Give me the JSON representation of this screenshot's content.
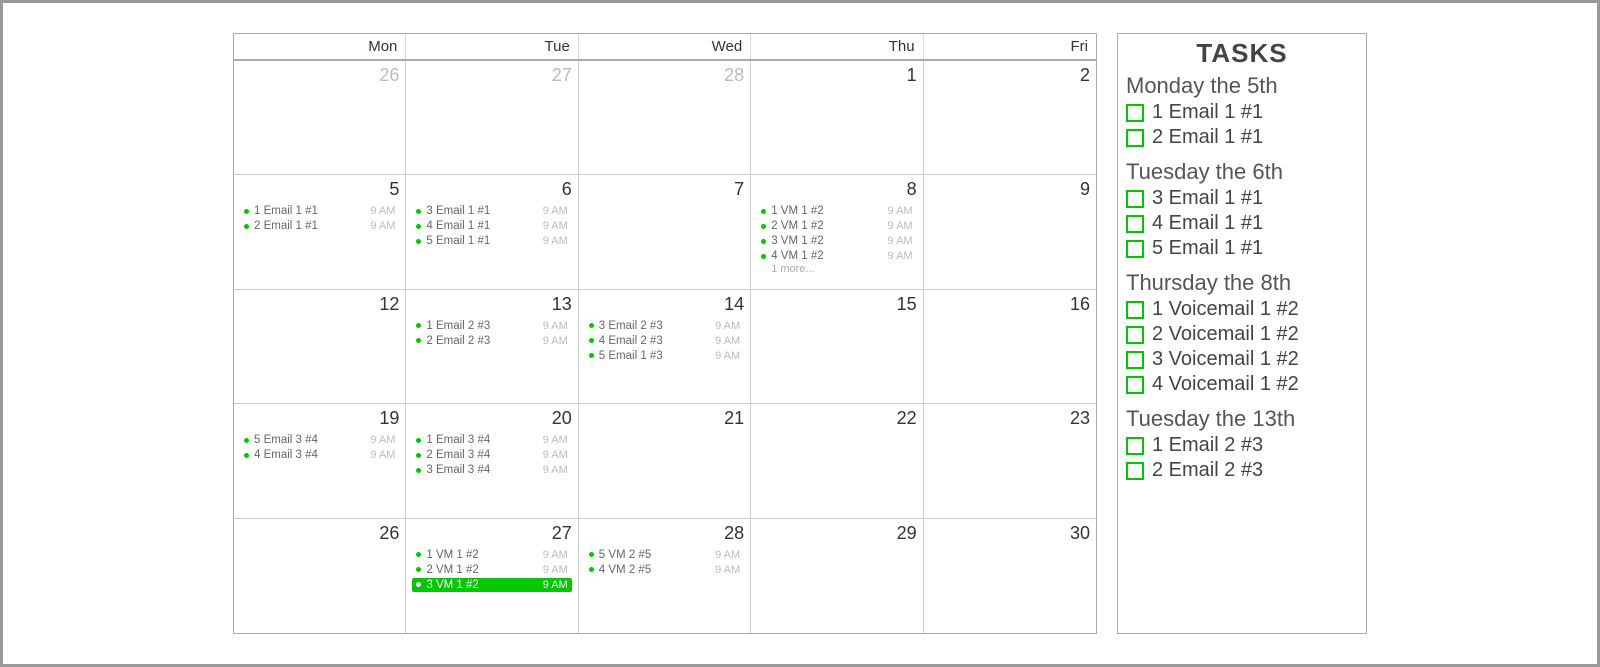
{
  "calendar": {
    "headers": [
      "Mon",
      "Tue",
      "Wed",
      "Thu",
      "Fri"
    ],
    "weeks": [
      [
        {
          "num": "26",
          "faded": true,
          "events": []
        },
        {
          "num": "27",
          "faded": true,
          "events": []
        },
        {
          "num": "28",
          "faded": true,
          "events": []
        },
        {
          "num": "1",
          "events": []
        },
        {
          "num": "2",
          "events": []
        }
      ],
      [
        {
          "num": "5",
          "events": [
            {
              "label": "1 Email 1 #1",
              "time": "9 AM"
            },
            {
              "label": "2 Email 1 #1",
              "time": "9 AM"
            }
          ]
        },
        {
          "num": "6",
          "events": [
            {
              "label": "3 Email 1 #1",
              "time": "9 AM"
            },
            {
              "label": "4 Email 1 #1",
              "time": "9 AM"
            },
            {
              "label": "5 Email 1 #1",
              "time": "9 AM"
            }
          ]
        },
        {
          "num": "7",
          "events": []
        },
        {
          "num": "8",
          "events": [
            {
              "label": "1 VM 1 #2",
              "time": "9 AM"
            },
            {
              "label": "2 VM 1 #2",
              "time": "9 AM"
            },
            {
              "label": "3 VM 1 #2",
              "time": "9 AM"
            },
            {
              "label": "4 VM 1 #2",
              "time": "9 AM"
            }
          ],
          "more": "1 more..."
        },
        {
          "num": "9",
          "events": []
        }
      ],
      [
        {
          "num": "12",
          "events": []
        },
        {
          "num": "13",
          "events": [
            {
              "label": "1 Email 2 #3",
              "time": "9 AM"
            },
            {
              "label": "2 Email 2 #3",
              "time": "9 AM"
            }
          ]
        },
        {
          "num": "14",
          "events": [
            {
              "label": "3 Email 2 #3",
              "time": "9 AM"
            },
            {
              "label": "4 Email 2 #3",
              "time": "9 AM"
            },
            {
              "label": "5 Email 1 #3",
              "time": "9 AM"
            }
          ]
        },
        {
          "num": "15",
          "events": []
        },
        {
          "num": "16",
          "events": []
        }
      ],
      [
        {
          "num": "19",
          "events": [
            {
              "label": "5 Email 3 #4",
              "time": "9 AM"
            },
            {
              "label": "4 Email 3 #4",
              "time": "9 AM"
            }
          ]
        },
        {
          "num": "20",
          "events": [
            {
              "label": "1 Email 3 #4",
              "time": "9 AM"
            },
            {
              "label": "2 Email 3 #4",
              "time": "9 AM"
            },
            {
              "label": "3 Email 3 #4",
              "time": "9 AM"
            }
          ]
        },
        {
          "num": "21",
          "events": []
        },
        {
          "num": "22",
          "events": []
        },
        {
          "num": "23",
          "events": []
        }
      ],
      [
        {
          "num": "26",
          "events": []
        },
        {
          "num": "27",
          "events": [
            {
              "label": "1 VM 1 #2",
              "time": "9 AM"
            },
            {
              "label": "2 VM 1 #2",
              "time": "9 AM"
            },
            {
              "label": "3 VM 1 #2",
              "time": "9 AM",
              "selected": true
            }
          ]
        },
        {
          "num": "28",
          "events": [
            {
              "label": "5 VM 2 #5",
              "time": "9 AM"
            },
            {
              "label": "4 VM 2 #5",
              "time": "9 AM"
            }
          ]
        },
        {
          "num": "29",
          "events": []
        },
        {
          "num": "30",
          "events": []
        }
      ]
    ]
  },
  "sidebar": {
    "title": "TASKS",
    "days": [
      {
        "heading": "Monday the 5th",
        "items": [
          "1 Email 1 #1",
          "2 Email 1 #1"
        ]
      },
      {
        "heading": "Tuesday the 6th",
        "items": [
          "3 Email 1 #1",
          "4 Email 1 #1",
          "5 Email 1 #1"
        ]
      },
      {
        "heading": "Thursday the 8th",
        "items": [
          "1 Voicemail 1 #2",
          "2 Voicemail 1 #2",
          "3 Voicemail 1 #2",
          "4 Voicemail 1 #2"
        ]
      },
      {
        "heading": "Tuesday the 13th",
        "items": [
          "1 Email 2 #3",
          "2 Email 2 #3"
        ]
      }
    ]
  }
}
